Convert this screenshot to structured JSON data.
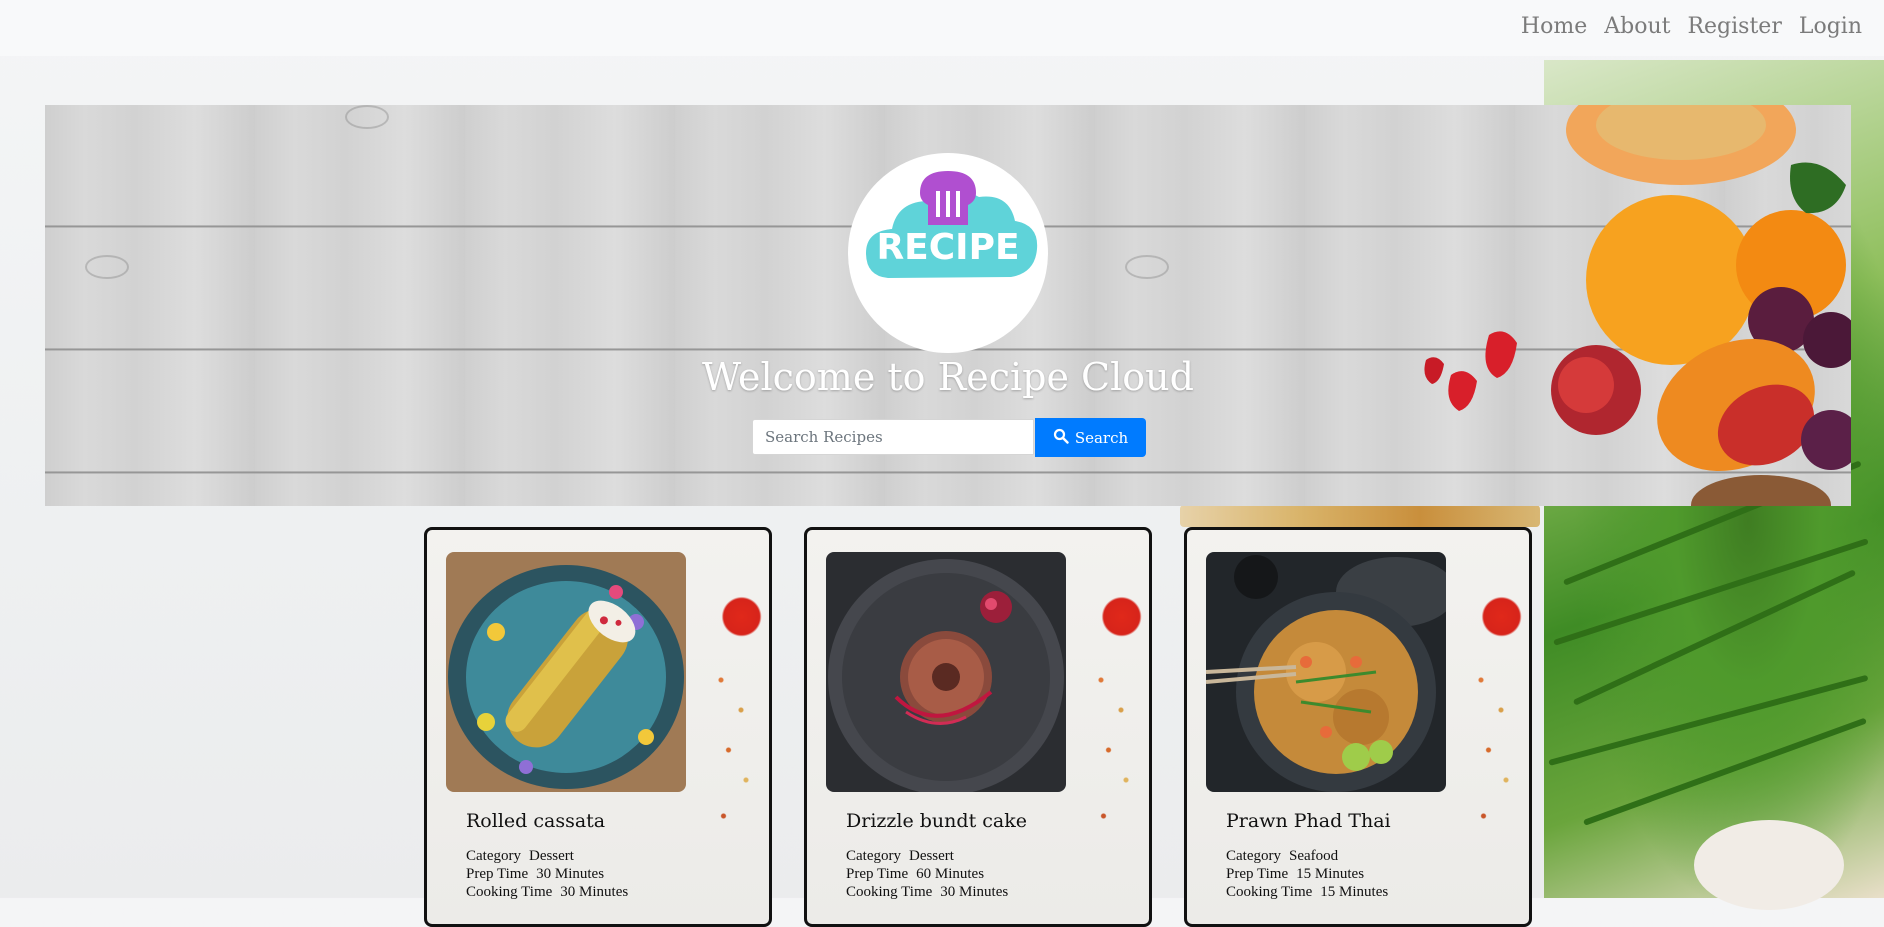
{
  "nav": {
    "links": [
      "Home",
      "About",
      "Register",
      "Login"
    ]
  },
  "hero": {
    "logo_text": "RECIPE",
    "welcome": "Welcome to Recipe Cloud",
    "search_placeholder": "Search Recipes",
    "search_button": "Search"
  },
  "recipes": [
    {
      "name": "Rolled cassata",
      "category_label": "Category",
      "category": "Dessert",
      "prep_label": "Prep Time",
      "prep": "30 Minutes",
      "cook_label": "Cooking Time",
      "cook": "30 Minutes"
    },
    {
      "name": "Drizzle bundt cake",
      "category_label": "Category",
      "category": "Dessert",
      "prep_label": "Prep Time",
      "prep": "60 Minutes",
      "cook_label": "Cooking Time",
      "cook": "30 Minutes"
    },
    {
      "name": "Prawn Phad Thai",
      "category_label": "Category",
      "category": "Seafood",
      "prep_label": "Prep Time",
      "prep": "15 Minutes",
      "cook_label": "Cooking Time",
      "cook": "15 Minutes"
    }
  ],
  "colors": {
    "primary": "#007bff",
    "logo_teal": "#5fd3d9",
    "logo_purple": "#b04fd0"
  }
}
